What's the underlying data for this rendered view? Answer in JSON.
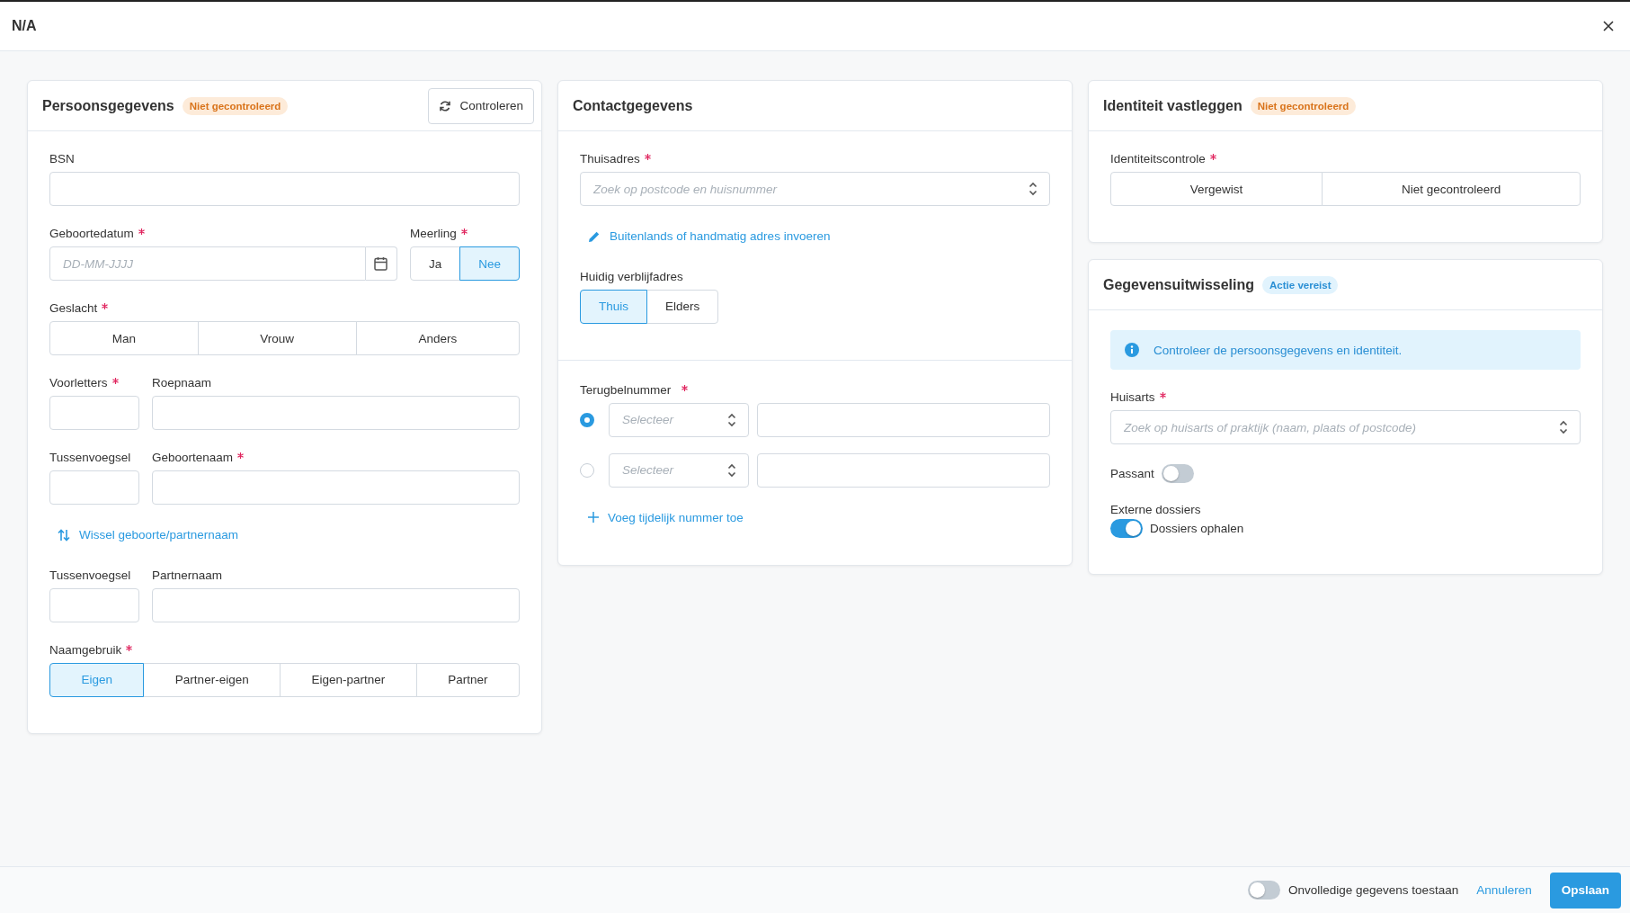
{
  "window": {
    "title": "N/A"
  },
  "columns": [
    {
      "cards": [
        {
          "title": "Persoonsgegevens",
          "badge": {
            "text": "Niet gecontroleerd",
            "kind": "warning"
          },
          "action": {
            "label": "Controleren"
          },
          "sections": [
            {
              "fields": [
                {
                  "kind": "input",
                  "label": "BSN",
                  "required": false
                },
                {
                  "kind": "row",
                  "fields": [
                    {
                      "kind": "date",
                      "label": "Geboortedatum",
                      "required": true,
                      "placeholder": "DD-MM-JJJJ"
                    },
                    {
                      "kind": "pills",
                      "label": "Meerling",
                      "required": true,
                      "options": [
                        {
                          "label": "Ja",
                          "selected": false
                        },
                        {
                          "label": "Nee",
                          "selected": true
                        }
                      ]
                    }
                  ]
                },
                {
                  "kind": "choice",
                  "label": "Geslacht",
                  "required": true,
                  "options": [
                    {
                      "label": "Man",
                      "selected": false
                    },
                    {
                      "label": "Vrouw",
                      "selected": false
                    },
                    {
                      "label": "Anders",
                      "selected": false
                    }
                  ]
                },
                {
                  "kind": "row",
                  "fields": [
                    {
                      "kind": "input",
                      "label": "Voorletters",
                      "required": true
                    },
                    {
                      "kind": "input",
                      "label": "Roepnaam",
                      "required": false
                    }
                  ]
                },
                {
                  "kind": "row",
                  "fields": [
                    {
                      "kind": "input",
                      "label": "Tussenvoegsel",
                      "required": false
                    },
                    {
                      "kind": "input",
                      "label": "Geboortenaam",
                      "required": true
                    }
                  ]
                },
                {
                  "kind": "swap-link",
                  "text": "Wissel geboorte/partnernaam"
                },
                {
                  "kind": "row",
                  "fields": [
                    {
                      "kind": "input",
                      "label": "Tussenvoegsel",
                      "required": false
                    },
                    {
                      "kind": "input",
                      "label": "Partnernaam",
                      "required": false
                    }
                  ]
                },
                {
                  "kind": "choice",
                  "label": "Naamgebruik",
                  "required": true,
                  "options": [
                    {
                      "label": "Eigen",
                      "selected": true
                    },
                    {
                      "label": "Partner-eigen",
                      "selected": false
                    },
                    {
                      "label": "Eigen-partner",
                      "selected": false
                    },
                    {
                      "label": "Partner",
                      "selected": false
                    }
                  ]
                }
              ]
            }
          ]
        }
      ]
    },
    {
      "cards": [
        {
          "title": "Contactgegevens",
          "sections": [
            {
              "fields": [
                {
                  "kind": "select",
                  "label": "Thuisadres",
                  "required": true,
                  "placeholder": "Zoek op postcode en huisnummer"
                },
                {
                  "kind": "edit-link",
                  "text": "Buitenlands of handmatig adres invoeren"
                },
                {
                  "kind": "pills",
                  "label": "Huidig verblijfadres",
                  "required": false,
                  "options": [
                    {
                      "label": "Thuis",
                      "selected": true
                    },
                    {
                      "label": "Elders",
                      "selected": false
                    }
                  ]
                }
              ]
            },
            {
              "fields": [
                {
                  "kind": "phone",
                  "label": "Terugbelnummer",
                  "required": true,
                  "lines": [
                    {
                      "selected": true,
                      "placeholder": "Selecteer"
                    },
                    {
                      "selected": false,
                      "placeholder": "Selecteer"
                    }
                  ]
                },
                {
                  "kind": "add-link",
                  "text": "Voeg tijdelijk nummer toe"
                }
              ]
            }
          ]
        }
      ]
    },
    {
      "cards": [
        {
          "title": "Identiteit vastleggen",
          "badge": {
            "text": "Niet gecontroleerd",
            "kind": "warning"
          },
          "sections": [
            {
              "fields": [
                {
                  "kind": "choice",
                  "label": "Identiteitscontrole",
                  "required": true,
                  "options": [
                    {
                      "label": "Vergewist",
                      "selected": false
                    },
                    {
                      "label": "Niet gecontroleerd",
                      "selected": false
                    }
                  ]
                }
              ]
            }
          ]
        },
        {
          "title": "Gegevensuitwisseling",
          "badge": {
            "text": "Actie vereist",
            "kind": "info"
          },
          "sections": [
            {
              "fields": [
                {
                  "kind": "info",
                  "text": "Controleer de persoonsgegevens en identiteit."
                },
                {
                  "kind": "select",
                  "label": "Huisarts",
                  "required": true,
                  "placeholder": "Zoek op huisarts of praktijk (naam, plaats of postcode)"
                },
                {
                  "kind": "switch",
                  "label": "Passant",
                  "on": false
                },
                {
                  "kind": "switch-group",
                  "label": "Externe dossiers",
                  "text": "Dossiers ophalen",
                  "on": true
                }
              ]
            }
          ]
        }
      ]
    }
  ],
  "footer": {
    "switch": {
      "label": "Onvolledige gegevens toestaan",
      "on": false
    },
    "cancel": "Annuleren",
    "save": "Opslaan"
  }
}
